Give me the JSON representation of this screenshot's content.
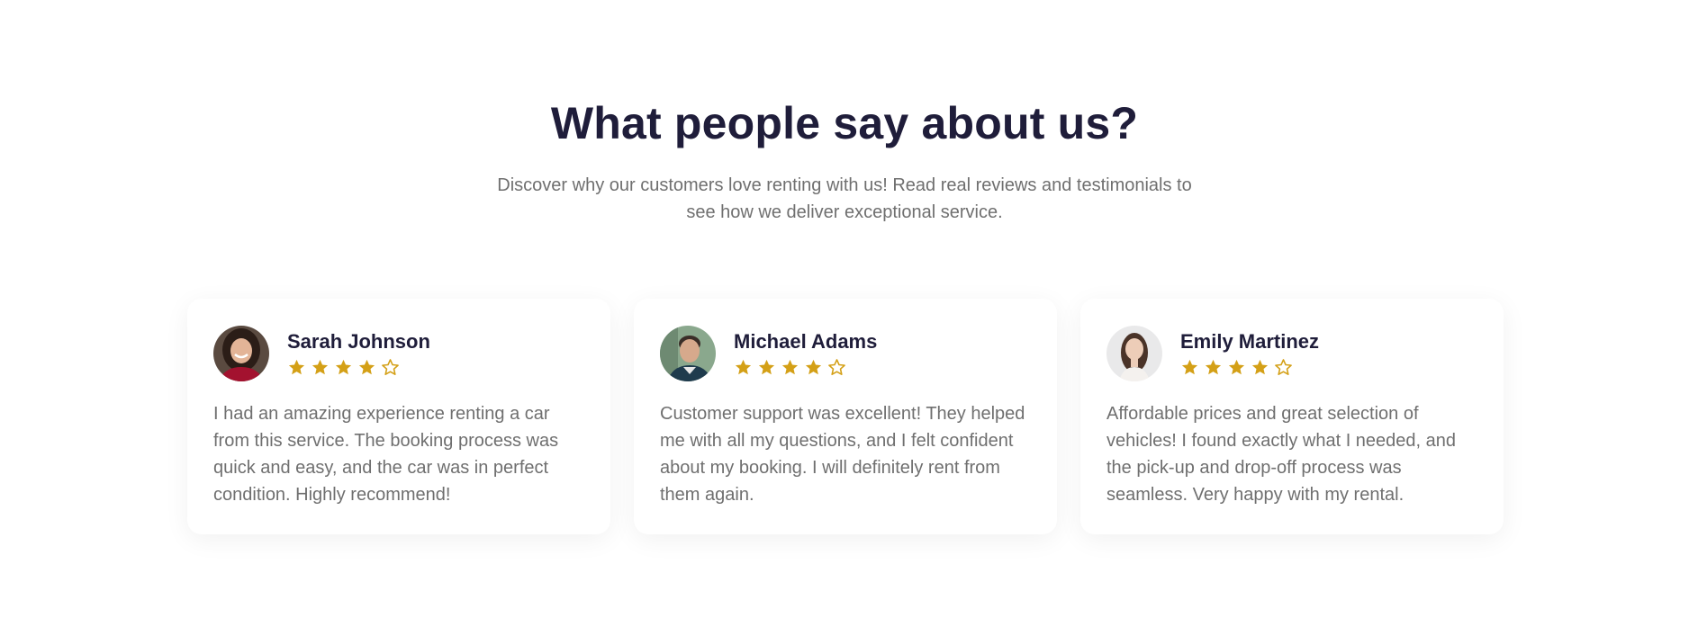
{
  "header": {
    "title": "What people say about us?",
    "subtitle": "Discover why our customers love renting with us! Read real reviews and testimonials to see how we deliver exceptional service."
  },
  "colors": {
    "heading": "#1f1d3a",
    "body_text": "#6f6f6f",
    "star": "#d4a017",
    "card_background": "#ffffff"
  },
  "testimonials": [
    {
      "name": "Sarah Johnson",
      "rating": 4,
      "max_rating": 5,
      "text": "I had an amazing experience renting a car from this service. The booking process was quick and easy, and the car was in perfect condition. Highly recommend!"
    },
    {
      "name": "Michael Adams",
      "rating": 4,
      "max_rating": 5,
      "text": "Customer support was excellent! They helped me with all my questions, and I felt confident about my booking. I will definitely rent from them again."
    },
    {
      "name": "Emily Martinez",
      "rating": 4,
      "max_rating": 5,
      "text": "Affordable prices and great selection of vehicles! I found exactly what I needed, and the pick-up and drop-off process was seamless. Very happy with my rental."
    }
  ]
}
